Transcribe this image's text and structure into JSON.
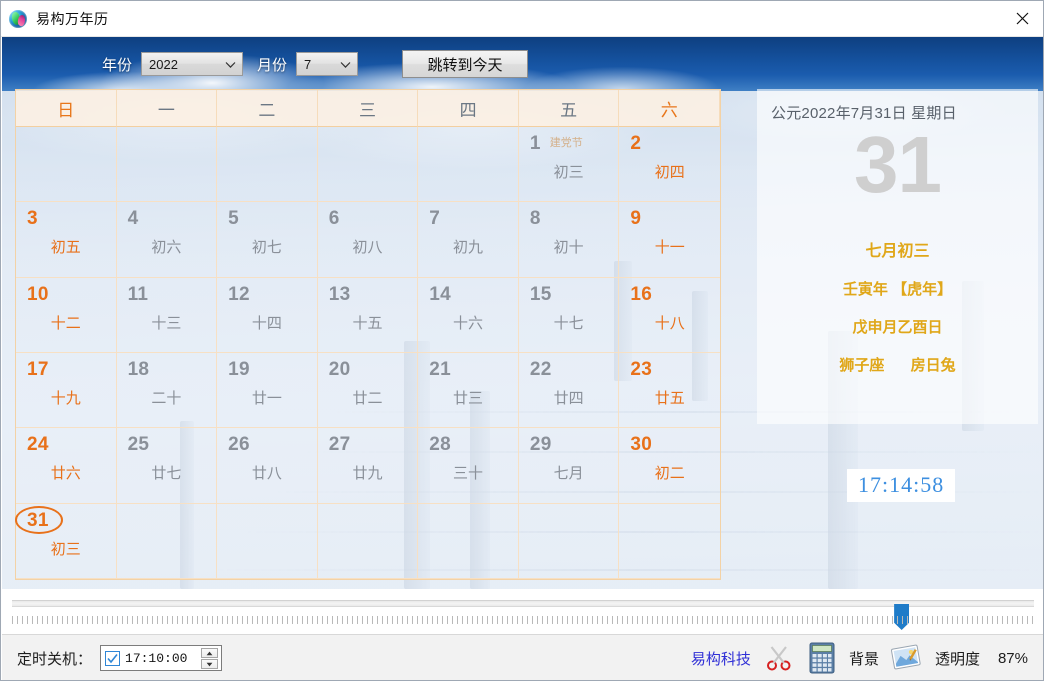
{
  "window": {
    "title": "易构万年历",
    "icon": "app-logo-icon",
    "close_label": "×"
  },
  "toolbar": {
    "year_label": "年份",
    "year_value": "2022",
    "month_label": "月份",
    "month_value": "7",
    "today_button": "跳转到今天"
  },
  "calendar": {
    "weekdays": [
      {
        "label": "日",
        "weekend": true
      },
      {
        "label": "一",
        "weekend": false
      },
      {
        "label": "二",
        "weekend": false
      },
      {
        "label": "三",
        "weekend": false
      },
      {
        "label": "四",
        "weekend": false
      },
      {
        "label": "五",
        "weekend": false
      },
      {
        "label": "六",
        "weekend": true
      }
    ],
    "cells": [
      {
        "day": "",
        "lunar": "",
        "festival": "",
        "weekend": true,
        "today": false,
        "empty": true
      },
      {
        "day": "",
        "lunar": "",
        "festival": "",
        "weekend": false,
        "today": false,
        "empty": true
      },
      {
        "day": "",
        "lunar": "",
        "festival": "",
        "weekend": false,
        "today": false,
        "empty": true
      },
      {
        "day": "",
        "lunar": "",
        "festival": "",
        "weekend": false,
        "today": false,
        "empty": true
      },
      {
        "day": "",
        "lunar": "",
        "festival": "",
        "weekend": false,
        "today": false,
        "empty": true
      },
      {
        "day": "1",
        "lunar": "初三",
        "festival": "建党节",
        "weekend": false,
        "today": false,
        "empty": false
      },
      {
        "day": "2",
        "lunar": "初四",
        "festival": "",
        "weekend": true,
        "today": false,
        "empty": false
      },
      {
        "day": "3",
        "lunar": "初五",
        "festival": "",
        "weekend": true,
        "today": false,
        "empty": false
      },
      {
        "day": "4",
        "lunar": "初六",
        "festival": "",
        "weekend": false,
        "today": false,
        "empty": false
      },
      {
        "day": "5",
        "lunar": "初七",
        "festival": "",
        "weekend": false,
        "today": false,
        "empty": false
      },
      {
        "day": "6",
        "lunar": "初八",
        "festival": "",
        "weekend": false,
        "today": false,
        "empty": false
      },
      {
        "day": "7",
        "lunar": "初九",
        "festival": "",
        "weekend": false,
        "today": false,
        "empty": false
      },
      {
        "day": "8",
        "lunar": "初十",
        "festival": "",
        "weekend": false,
        "today": false,
        "empty": false
      },
      {
        "day": "9",
        "lunar": "十一",
        "festival": "",
        "weekend": true,
        "today": false,
        "empty": false
      },
      {
        "day": "10",
        "lunar": "十二",
        "festival": "",
        "weekend": true,
        "today": false,
        "empty": false
      },
      {
        "day": "11",
        "lunar": "十三",
        "festival": "",
        "weekend": false,
        "today": false,
        "empty": false
      },
      {
        "day": "12",
        "lunar": "十四",
        "festival": "",
        "weekend": false,
        "today": false,
        "empty": false
      },
      {
        "day": "13",
        "lunar": "十五",
        "festival": "",
        "weekend": false,
        "today": false,
        "empty": false
      },
      {
        "day": "14",
        "lunar": "十六",
        "festival": "",
        "weekend": false,
        "today": false,
        "empty": false
      },
      {
        "day": "15",
        "lunar": "十七",
        "festival": "",
        "weekend": false,
        "today": false,
        "empty": false
      },
      {
        "day": "16",
        "lunar": "十八",
        "festival": "",
        "weekend": true,
        "today": false,
        "empty": false
      },
      {
        "day": "17",
        "lunar": "十九",
        "festival": "",
        "weekend": true,
        "today": false,
        "empty": false
      },
      {
        "day": "18",
        "lunar": "二十",
        "festival": "",
        "weekend": false,
        "today": false,
        "empty": false
      },
      {
        "day": "19",
        "lunar": "廿一",
        "festival": "",
        "weekend": false,
        "today": false,
        "empty": false
      },
      {
        "day": "20",
        "lunar": "廿二",
        "festival": "",
        "weekend": false,
        "today": false,
        "empty": false
      },
      {
        "day": "21",
        "lunar": "廿三",
        "festival": "",
        "weekend": false,
        "today": false,
        "empty": false
      },
      {
        "day": "22",
        "lunar": "廿四",
        "festival": "",
        "weekend": false,
        "today": false,
        "empty": false
      },
      {
        "day": "23",
        "lunar": "廿五",
        "festival": "",
        "weekend": true,
        "today": false,
        "empty": false
      },
      {
        "day": "24",
        "lunar": "廿六",
        "festival": "",
        "weekend": true,
        "today": false,
        "empty": false
      },
      {
        "day": "25",
        "lunar": "廿七",
        "festival": "",
        "weekend": false,
        "today": false,
        "empty": false
      },
      {
        "day": "26",
        "lunar": "廿八",
        "festival": "",
        "weekend": false,
        "today": false,
        "empty": false
      },
      {
        "day": "27",
        "lunar": "廿九",
        "festival": "",
        "weekend": false,
        "today": false,
        "empty": false
      },
      {
        "day": "28",
        "lunar": "三十",
        "festival": "",
        "weekend": false,
        "today": false,
        "empty": false
      },
      {
        "day": "29",
        "lunar": "七月",
        "festival": "",
        "weekend": false,
        "today": false,
        "empty": false
      },
      {
        "day": "30",
        "lunar": "初二",
        "festival": "",
        "weekend": true,
        "today": false,
        "empty": false
      },
      {
        "day": "31",
        "lunar": "初三",
        "festival": "",
        "weekend": true,
        "today": true,
        "empty": false
      },
      {
        "day": "",
        "lunar": "",
        "festival": "",
        "weekend": false,
        "today": false,
        "empty": true
      },
      {
        "day": "",
        "lunar": "",
        "festival": "",
        "weekend": false,
        "today": false,
        "empty": true
      },
      {
        "day": "",
        "lunar": "",
        "festival": "",
        "weekend": false,
        "today": false,
        "empty": true
      },
      {
        "day": "",
        "lunar": "",
        "festival": "",
        "weekend": false,
        "today": false,
        "empty": true
      },
      {
        "day": "",
        "lunar": "",
        "festival": "",
        "weekend": false,
        "today": false,
        "empty": true
      },
      {
        "day": "",
        "lunar": "",
        "festival": "",
        "weekend": true,
        "today": false,
        "empty": true
      }
    ]
  },
  "info_panel": {
    "gregorian_date": "公元2022年7月31日 星期日",
    "big_day": "31",
    "lunar_date": "七月初三",
    "ganzhi_year": "壬寅年 【虎年】",
    "ganzhi_month_day": "戊申月乙酉日",
    "zodiac_sign": "狮子座",
    "constellation": "房日兔"
  },
  "clock": {
    "time": "17:14:58"
  },
  "slider": {
    "value_percent": 87
  },
  "statusbar": {
    "shutdown_label": "定时关机：",
    "shutdown_checked": true,
    "shutdown_time": "17:10:00",
    "brand": "易构科技",
    "scissors_icon": "scissors-icon",
    "calculator_icon": "calculator-icon",
    "background_label": "背景",
    "picture_icon": "picture-icon",
    "opacity_label": "透明度",
    "opacity_value": "87%"
  },
  "colors": {
    "accent_orange": "#e8711a",
    "gold": "#e0a719",
    "clock_blue": "#3d8fe0",
    "link_blue": "#2f2fd6",
    "slider_blue": "#1e7bc8"
  }
}
